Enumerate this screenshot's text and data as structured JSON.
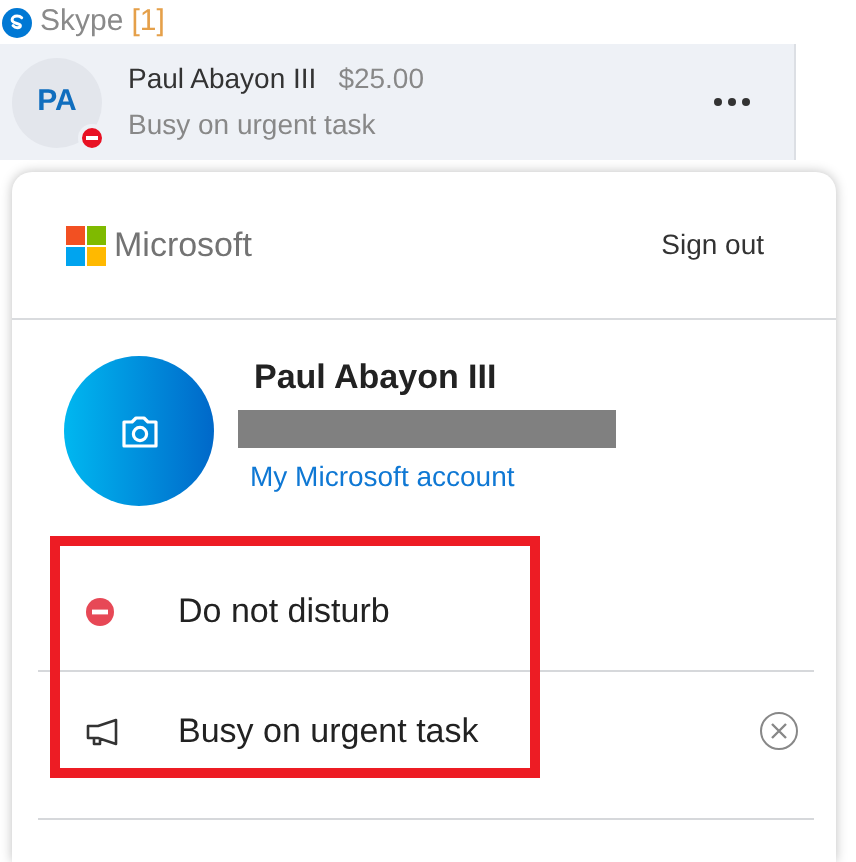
{
  "app": {
    "title": "Skype",
    "badge": "[1]"
  },
  "contact": {
    "initials": "PA",
    "name": "Paul Abayon III",
    "balance": "$25.00",
    "mood": "Busy on urgent task",
    "busy": true
  },
  "account_panel": {
    "brand": "Microsoft",
    "sign_out": "Sign out",
    "name": "Paul Abayon III",
    "email_redacted": true,
    "account_link": "My Microsoft account"
  },
  "status_items": [
    {
      "kind": "presence",
      "label": "Do not disturb",
      "clearable": false
    },
    {
      "kind": "mood",
      "label": "Busy on urgent task",
      "clearable": true
    }
  ],
  "highlight_frame": true
}
